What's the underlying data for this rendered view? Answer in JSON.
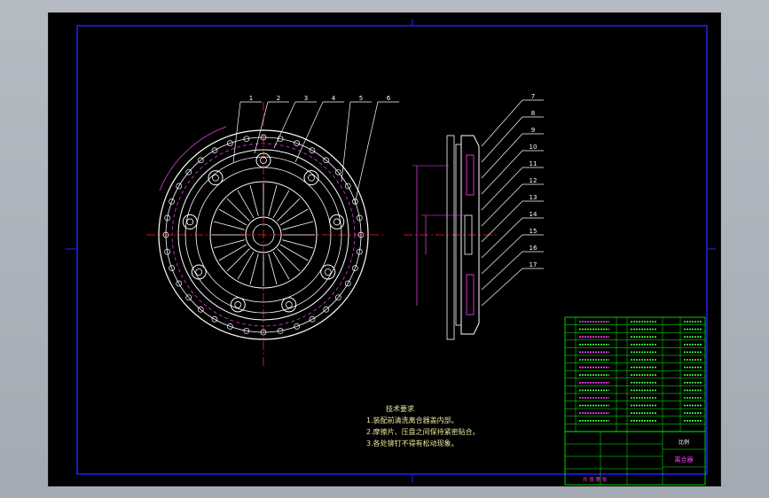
{
  "colors": {
    "sheet_bg": "#000000",
    "frame": "#ffffff",
    "inner_frame": "#2020ff",
    "part_outline": "#ffffff",
    "center_line": "#ff2020",
    "leader": "#ffffff",
    "dimension": "#ff40ff",
    "hidden_line": "#ff40ff",
    "table_lines": "#00ff00",
    "table_text_green": "#40ff40",
    "table_text_magenta": "#ff40ff",
    "notes_text": "#e8e8a0"
  },
  "balloons_front": [
    "1",
    "2",
    "3",
    "4",
    "5",
    "6"
  ],
  "balloons_section": [
    "7",
    "8",
    "9",
    "10",
    "11",
    "12",
    "13",
    "14",
    "15",
    "16",
    "17"
  ],
  "notes": {
    "title": "技术要求",
    "items": [
      "1.装配前清洗离合器盖内部。",
      "2.摩擦片、压盘之间保持紧密贴合。",
      "3.各处铆钉不得有松动现象。"
    ]
  },
  "title_block": {
    "drawing_name": "离合器",
    "scale_label": "比例",
    "sheet_label": "共 张 第 张"
  }
}
